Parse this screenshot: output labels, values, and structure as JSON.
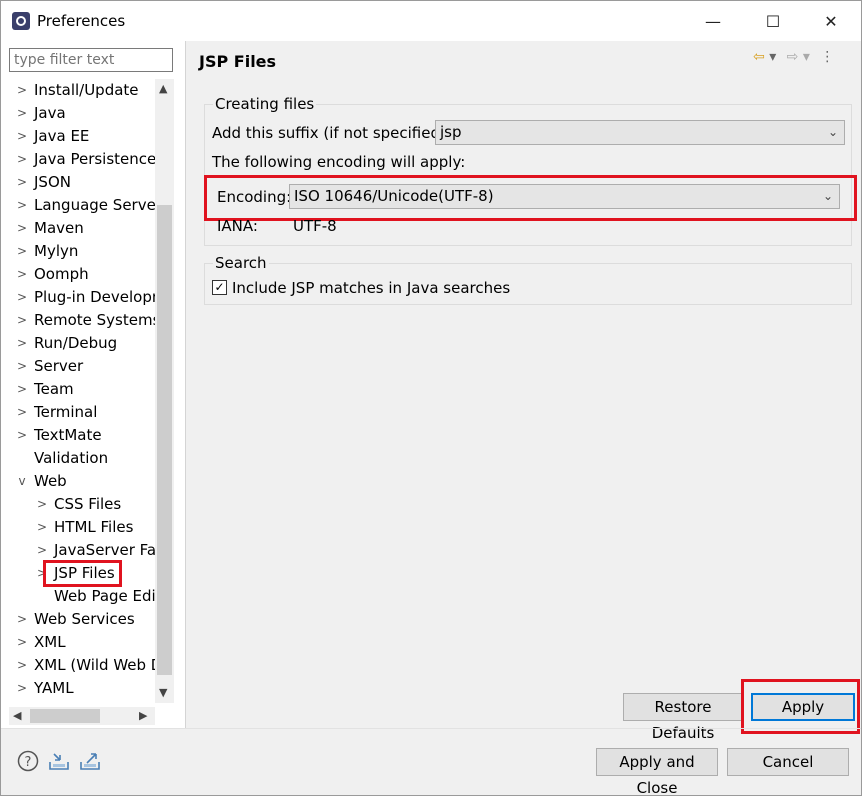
{
  "window": {
    "title": "Preferences",
    "controls": {
      "minimize": "—",
      "maximize": "☐",
      "close": "✕"
    }
  },
  "filter": {
    "placeholder": "type filter text"
  },
  "tree": {
    "items": [
      {
        "label": "Install/Update",
        "expander": ">"
      },
      {
        "label": "Java",
        "expander": ">"
      },
      {
        "label": "Java EE",
        "expander": ">"
      },
      {
        "label": "Java Persistence",
        "expander": ">"
      },
      {
        "label": "JSON",
        "expander": ">"
      },
      {
        "label": "Language Servers",
        "expander": ">"
      },
      {
        "label": "Maven",
        "expander": ">"
      },
      {
        "label": "Mylyn",
        "expander": ">"
      },
      {
        "label": "Oomph",
        "expander": ">"
      },
      {
        "label": "Plug-in Developm",
        "expander": ">"
      },
      {
        "label": "Remote Systems",
        "expander": ">"
      },
      {
        "label": "Run/Debug",
        "expander": ">"
      },
      {
        "label": "Server",
        "expander": ">"
      },
      {
        "label": "Team",
        "expander": ">"
      },
      {
        "label": "Terminal",
        "expander": ">"
      },
      {
        "label": "TextMate",
        "expander": ">"
      },
      {
        "label": "Validation",
        "expander": ""
      },
      {
        "label": "Web",
        "expander": "v"
      },
      {
        "label": "CSS Files",
        "expander": ">"
      },
      {
        "label": "HTML Files",
        "expander": ">"
      },
      {
        "label": "JavaServer Face",
        "expander": ">"
      },
      {
        "label": "JSP Files",
        "expander": ">"
      },
      {
        "label": "Web Page Edit",
        "expander": ""
      },
      {
        "label": "Web Services",
        "expander": ">"
      },
      {
        "label": "XML",
        "expander": ">"
      },
      {
        "label": "XML (Wild Web D",
        "expander": ">"
      },
      {
        "label": "YAML",
        "expander": ">"
      }
    ]
  },
  "page": {
    "title": "JSP Files",
    "nav_icons": {
      "back": "⇦",
      "back_menu": "▾",
      "forward": "⇨",
      "forward_menu": "▾",
      "menu": "⋮"
    },
    "creating_files": {
      "label": "Creating files",
      "suffix_label": "Add this suffix (if not specified):",
      "suffix_value": "jsp",
      "encoding_note": "The following encoding will apply:",
      "encoding_label": "Encoding:",
      "encoding_value": "ISO 10646/Unicode(UTF-8)",
      "iana_label": "IANA:",
      "iana_value": "UTF-8"
    },
    "search": {
      "label": "Search",
      "include_jsp_label": "Include JSP matches in Java searches",
      "include_jsp_checked": true,
      "check_mark": "✓"
    },
    "restore_defaults": "Restore Defaults",
    "apply": "Apply"
  },
  "footer": {
    "apply_close": "Apply and Close",
    "cancel": "Cancel",
    "help_icon": "?"
  },
  "colors": {
    "highlight": "#e0131f",
    "focus_border": "#0078d7"
  }
}
